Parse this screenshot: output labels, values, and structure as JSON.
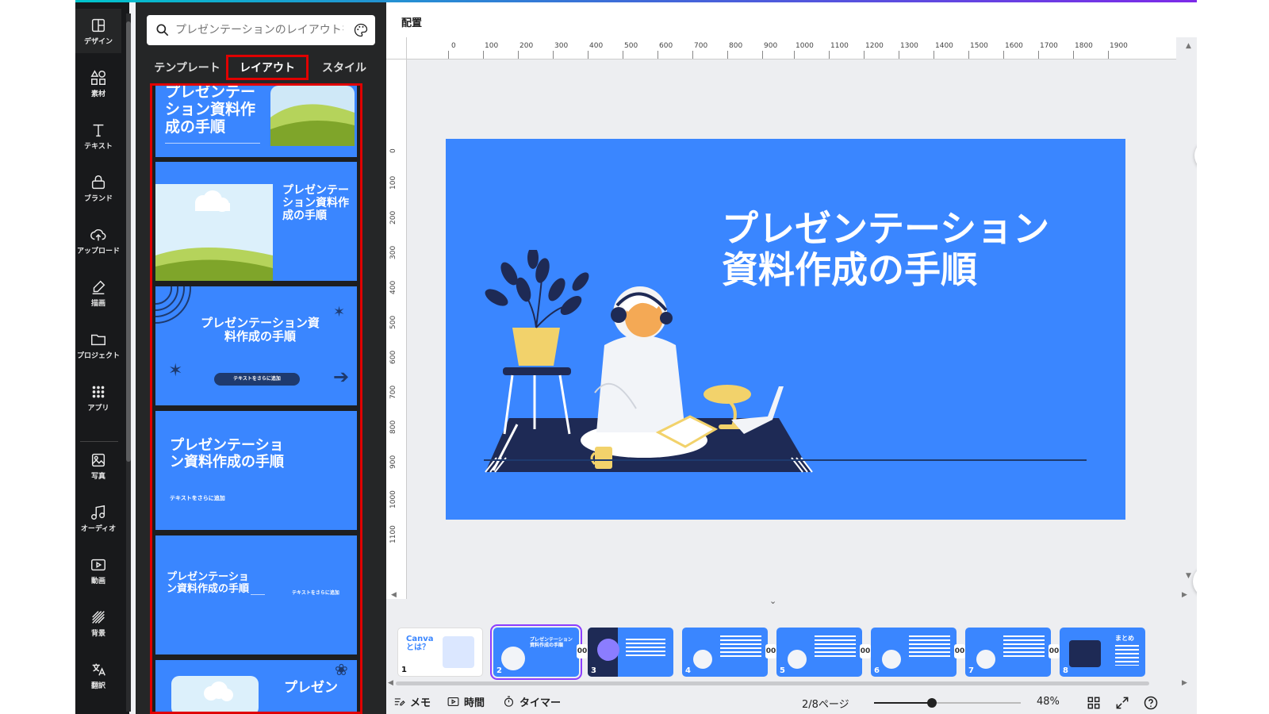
{
  "rail": {
    "items": [
      {
        "label": "デザイン",
        "icon": "design-icon"
      },
      {
        "label": "素材",
        "icon": "elements-icon"
      },
      {
        "label": "テキスト",
        "icon": "text-icon"
      },
      {
        "label": "ブランド",
        "icon": "brand-icon"
      },
      {
        "label": "アップロード",
        "icon": "upload-icon"
      },
      {
        "label": "描画",
        "icon": "draw-icon"
      },
      {
        "label": "プロジェクト",
        "icon": "folder-icon"
      },
      {
        "label": "アプリ",
        "icon": "apps-icon"
      },
      {
        "label": "写真",
        "icon": "photo-icon"
      },
      {
        "label": "オーディオ",
        "icon": "audio-icon"
      },
      {
        "label": "動画",
        "icon": "video-icon"
      },
      {
        "label": "背景",
        "icon": "background-icon"
      },
      {
        "label": "翻訳",
        "icon": "translate-icon"
      }
    ]
  },
  "panel": {
    "search_placeholder": "プレゼンテーションのレイアウトを検",
    "tabs": [
      "テンプレート",
      "レイアウト",
      "スタイル"
    ],
    "active_tab": "レイアウト",
    "cards": [
      {
        "title": "プレゼンテーション資料作成の手順"
      },
      {
        "title": "プレゼンテーション資料作成の手順"
      },
      {
        "title": "プレゼンテーション資料作成の手順",
        "button": "テキストをさらに追加"
      },
      {
        "title": "プレゼンテーション資料作成の手順",
        "sub": "テキストをさらに追加"
      },
      {
        "title": "プレゼンテーション資料作成の手順",
        "sub": "テキストをさらに追加"
      },
      {
        "title": "プレゼン"
      }
    ]
  },
  "editor": {
    "arrange_label": "配置",
    "ruler_h": [
      "0",
      "100",
      "200",
      "300",
      "400",
      "500",
      "600",
      "700",
      "800",
      "900",
      "1000",
      "1100",
      "1200",
      "1300",
      "1400",
      "1500",
      "1600",
      "1700",
      "1800",
      "1900"
    ],
    "ruler_v": [
      "0",
      "100",
      "200",
      "300",
      "400",
      "500",
      "600",
      "700",
      "800",
      "900",
      "1000",
      "1100"
    ],
    "slide_title_line1": "プレゼンテーション",
    "slide_title_line2": "資料作成の手順"
  },
  "pages": [
    {
      "num": "1",
      "title": "Canva とは？"
    },
    {
      "num": "2",
      "title": "プレゼンテーション資料作成の手順"
    },
    {
      "num": "3",
      "title": ""
    },
    {
      "num": "4",
      "title": ""
    },
    {
      "num": "5",
      "title": ""
    },
    {
      "num": "6",
      "title": ""
    },
    {
      "num": "7",
      "title": ""
    },
    {
      "num": "8",
      "title": "まとめ"
    }
  ],
  "bottombar": {
    "memo": "メモ",
    "time": "時間",
    "timer": "タイマー",
    "page_indicator": "2/8ページ",
    "zoom": "48%",
    "zoom_value": 0.48
  },
  "colors": {
    "accent": "#8b3dff",
    "slide_blue": "#3a86ff",
    "highlight_red": "#e00000"
  }
}
